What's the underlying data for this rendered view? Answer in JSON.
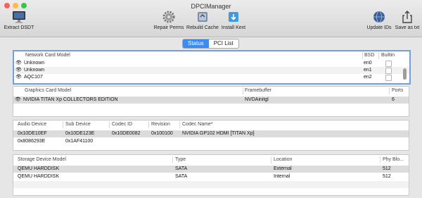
{
  "window": {
    "title": "DPCIManager"
  },
  "toolbar": {
    "extract_dsdt": "Extract DSDT",
    "repair_perms": "Repair Perms",
    "rebuild_cache": "Rebuild Cache",
    "install_kext": "Install Kext",
    "update_ids": "Update IDs",
    "save_as_txt": "Save as txt"
  },
  "tabs": {
    "status": "Status",
    "pci_list": "PCI List",
    "active": "Status"
  },
  "network": {
    "headers": {
      "model": "Network Card Model",
      "bsd": "BSD",
      "builtin": "Builtin"
    },
    "rows": [
      {
        "model": "Unknown",
        "bsd": "en0"
      },
      {
        "model": "Unknown",
        "bsd": "en1"
      },
      {
        "model": "AQC107",
        "bsd": "en2"
      }
    ]
  },
  "graphics": {
    "headers": {
      "model": "Graphics Card Model",
      "framebuffer": "Framebuffer",
      "ports": "Ports"
    },
    "rows": [
      {
        "model": "NVIDIA TITAN Xp COLLECTORS EDITION",
        "framebuffer": "NVDAinitgl",
        "ports": "6"
      }
    ]
  },
  "audio": {
    "headers": {
      "device": "Audio Device",
      "sub_device": "Sub Device",
      "codec_id": "Codec ID",
      "revision": "Revision",
      "codec_name": "Codec Name*"
    },
    "rows": [
      {
        "device": "0x10DE10EF",
        "sub_device": "0x10DE123E",
        "codec_id": "0x10DE0082",
        "revision": "0x100100",
        "codec_name": "NVIDIA GP102 HDMI [TITAN Xp]"
      },
      {
        "device": "0x8086293E",
        "sub_device": "0x1AF41100",
        "codec_id": "",
        "revision": "",
        "codec_name": ""
      }
    ]
  },
  "storage": {
    "headers": {
      "model": "Storage Device Model",
      "type": "Type",
      "location": "Location",
      "phy_block": "Phy Blo..."
    },
    "rows": [
      {
        "model": "QEMU HARDDISK",
        "type": "SATA",
        "location": "External",
        "phy_block": "512"
      },
      {
        "model": "QEMU HARDDISK",
        "type": "SATA",
        "location": "Internal",
        "phy_block": "512"
      }
    ]
  }
}
